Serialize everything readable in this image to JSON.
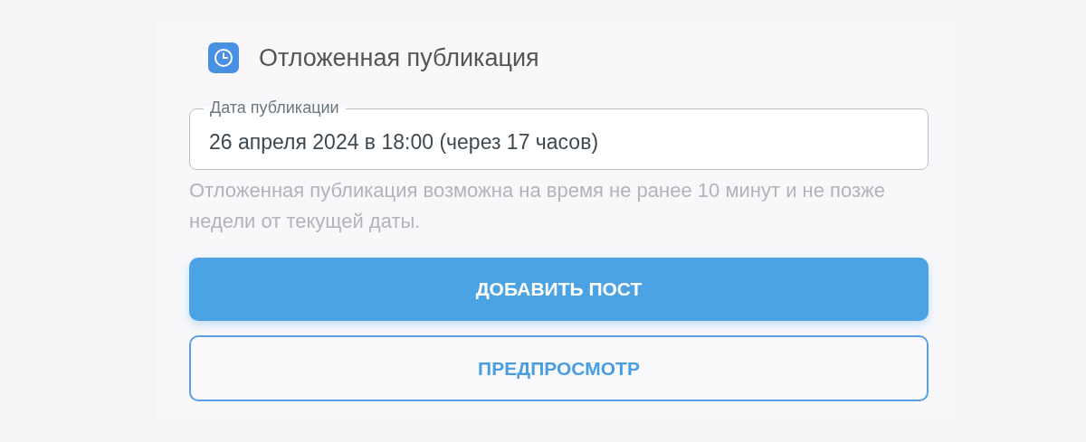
{
  "section": {
    "title": "Отложенная публикация"
  },
  "date_field": {
    "label": "Дата публикации",
    "value": "26 апреля 2024 в 18:00 (через 17 часов)"
  },
  "hint": "Отложенная публикация возможна на время не ранее 10 минут и не позже недели от текущей даты.",
  "buttons": [
    {
      "label": "ДОБАВИТЬ ПОСТ",
      "kind": "primary"
    },
    {
      "label": "ПРЕДПРОСМОТР",
      "kind": "outline"
    }
  ]
}
